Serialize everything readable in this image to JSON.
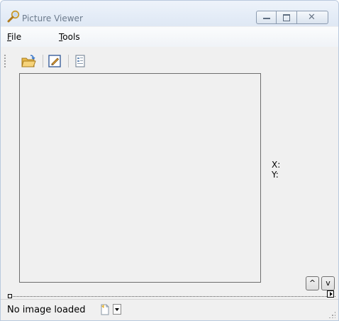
{
  "window": {
    "title": "Picture Viewer",
    "icon": "magnifier-icon",
    "caption_buttons": {
      "minimize": "minimize-icon",
      "maximize": "maximize-icon",
      "close_glyph": "✕"
    }
  },
  "menu": {
    "items": [
      {
        "accel": "F",
        "rest": "ile"
      },
      {
        "accel": "T",
        "rest": "ools"
      }
    ]
  },
  "toolbar": {
    "buttons": [
      "open-folder-icon",
      "edit-pencil-icon",
      "properties-icon"
    ]
  },
  "coords": {
    "x_label": "X:",
    "y_label": "Y:"
  },
  "nav": {
    "up_label": "^",
    "down_label": "v"
  },
  "status": {
    "text": "No image loaded",
    "icon": "new-document-icon"
  },
  "colors": {
    "window_bg": "#f0f0f0",
    "titlebar": "#dfe8f4",
    "border": "#b9c9de"
  }
}
